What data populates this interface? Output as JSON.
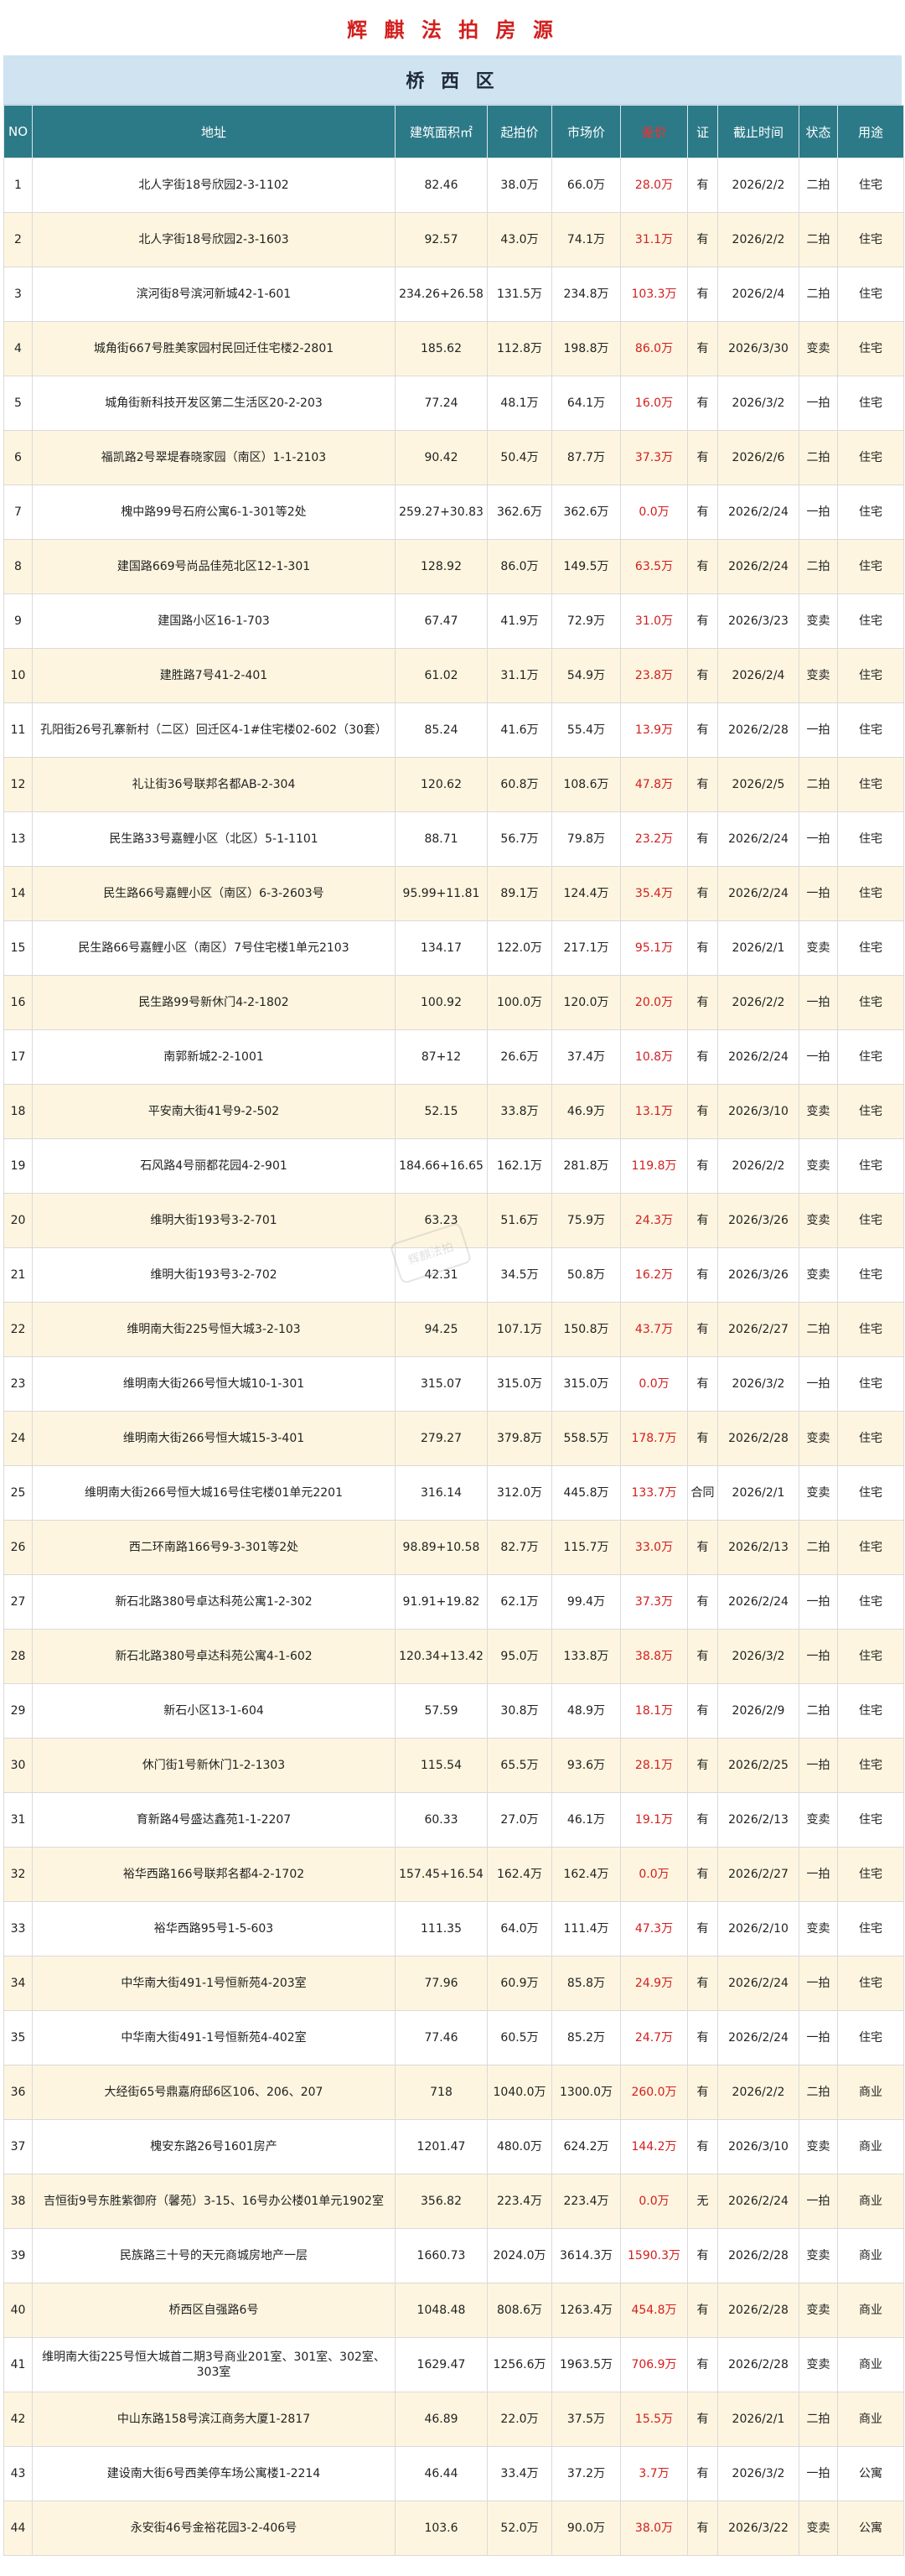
{
  "title": "辉 麒 法 拍 房 源",
  "district": "桥 西 区",
  "watermark": "辉麒法拍",
  "colors": {
    "title": "#d2201e",
    "header_bg": "#2c7a88",
    "district_bg": "#cfe3f1",
    "alt_row": "#fdf5df",
    "diff": "#d21e1e"
  },
  "columns": [
    "NO",
    "地址",
    "建筑面积㎡",
    "起拍价",
    "市场价",
    "差价",
    "证",
    "截止时间",
    "状态",
    "用途"
  ],
  "rows": [
    [
      "1",
      "北人字街18号欣园2-3-1102",
      "82.46",
      "38.0万",
      "66.0万",
      "28.0万",
      "有",
      "2026/2/2",
      "二拍",
      "住宅"
    ],
    [
      "2",
      "北人字街18号欣园2-3-1603",
      "92.57",
      "43.0万",
      "74.1万",
      "31.1万",
      "有",
      "2026/2/2",
      "二拍",
      "住宅"
    ],
    [
      "3",
      "滨河街8号滨河新城42-1-601",
      "234.26+26.58",
      "131.5万",
      "234.8万",
      "103.3万",
      "有",
      "2026/2/4",
      "二拍",
      "住宅"
    ],
    [
      "4",
      "城角街667号胜美家园村民回迁住宅楼2-2801",
      "185.62",
      "112.8万",
      "198.8万",
      "86.0万",
      "有",
      "2026/3/30",
      "变卖",
      "住宅"
    ],
    [
      "5",
      "城角街新科技开发区第二生活区20-2-203",
      "77.24",
      "48.1万",
      "64.1万",
      "16.0万",
      "有",
      "2026/3/2",
      "一拍",
      "住宅"
    ],
    [
      "6",
      "福凯路2号翠堤春晓家园（南区）1-1-2103",
      "90.42",
      "50.4万",
      "87.7万",
      "37.3万",
      "有",
      "2026/2/6",
      "二拍",
      "住宅"
    ],
    [
      "7",
      "槐中路99号石府公寓6-1-301等2处",
      "259.27+30.83",
      "362.6万",
      "362.6万",
      "0.0万",
      "有",
      "2026/2/24",
      "一拍",
      "住宅"
    ],
    [
      "8",
      "建国路669号尚品佳苑北区12-1-301",
      "128.92",
      "86.0万",
      "149.5万",
      "63.5万",
      "有",
      "2026/2/24",
      "二拍",
      "住宅"
    ],
    [
      "9",
      "建国路小区16-1-703",
      "67.47",
      "41.9万",
      "72.9万",
      "31.0万",
      "有",
      "2026/3/23",
      "变卖",
      "住宅"
    ],
    [
      "10",
      "建胜路7号41-2-401",
      "61.02",
      "31.1万",
      "54.9万",
      "23.8万",
      "有",
      "2026/2/4",
      "变卖",
      "住宅"
    ],
    [
      "11",
      "孔阳街26号孔寨新村（二区）回迁区4-1#住宅楼02-602（30套）",
      "85.24",
      "41.6万",
      "55.4万",
      "13.9万",
      "有",
      "2026/2/28",
      "一拍",
      "住宅"
    ],
    [
      "12",
      "礼让街36号联邦名都AB-2-304",
      "120.62",
      "60.8万",
      "108.6万",
      "47.8万",
      "有",
      "2026/2/5",
      "二拍",
      "住宅"
    ],
    [
      "13",
      "民生路33号嘉鲤小区（北区）5-1-1101",
      "88.71",
      "56.7万",
      "79.8万",
      "23.2万",
      "有",
      "2026/2/24",
      "一拍",
      "住宅"
    ],
    [
      "14",
      "民生路66号嘉鲤小区（南区）6-3-2603号",
      "95.99+11.81",
      "89.1万",
      "124.4万",
      "35.4万",
      "有",
      "2026/2/24",
      "一拍",
      "住宅"
    ],
    [
      "15",
      "民生路66号嘉鲤小区（南区）7号住宅楼1单元2103",
      "134.17",
      "122.0万",
      "217.1万",
      "95.1万",
      "有",
      "2026/2/1",
      "变卖",
      "住宅"
    ],
    [
      "16",
      "民生路99号新休门4-2-1802",
      "100.92",
      "100.0万",
      "120.0万",
      "20.0万",
      "有",
      "2026/2/2",
      "一拍",
      "住宅"
    ],
    [
      "17",
      "南郭新城2-2-1001",
      "87+12",
      "26.6万",
      "37.4万",
      "10.8万",
      "有",
      "2026/2/24",
      "一拍",
      "住宅"
    ],
    [
      "18",
      "平安南大街41号9-2-502",
      "52.15",
      "33.8万",
      "46.9万",
      "13.1万",
      "有",
      "2026/3/10",
      "变卖",
      "住宅"
    ],
    [
      "19",
      "石风路4号丽都花园4-2-901",
      "184.66+16.65",
      "162.1万",
      "281.8万",
      "119.8万",
      "有",
      "2026/2/2",
      "变卖",
      "住宅"
    ],
    [
      "20",
      "维明大街193号3-2-701",
      "63.23",
      "51.6万",
      "75.9万",
      "24.3万",
      "有",
      "2026/3/26",
      "变卖",
      "住宅"
    ],
    [
      "21",
      "维明大街193号3-2-702",
      "42.31",
      "34.5万",
      "50.8万",
      "16.2万",
      "有",
      "2026/3/26",
      "变卖",
      "住宅"
    ],
    [
      "22",
      "维明南大街225号恒大城3-2-103",
      "94.25",
      "107.1万",
      "150.8万",
      "43.7万",
      "有",
      "2026/2/27",
      "二拍",
      "住宅"
    ],
    [
      "23",
      "维明南大街266号恒大城10-1-301",
      "315.07",
      "315.0万",
      "315.0万",
      "0.0万",
      "有",
      "2026/3/2",
      "一拍",
      "住宅"
    ],
    [
      "24",
      "维明南大街266号恒大城15-3-401",
      "279.27",
      "379.8万",
      "558.5万",
      "178.7万",
      "有",
      "2026/2/28",
      "变卖",
      "住宅"
    ],
    [
      "25",
      "维明南大街266号恒大城16号住宅楼01单元2201",
      "316.14",
      "312.0万",
      "445.8万",
      "133.7万",
      "合同",
      "2026/2/1",
      "变卖",
      "住宅"
    ],
    [
      "26",
      "西二环南路166号9-3-301等2处",
      "98.89+10.58",
      "82.7万",
      "115.7万",
      "33.0万",
      "有",
      "2026/2/13",
      "二拍",
      "住宅"
    ],
    [
      "27",
      "新石北路380号卓达科苑公寓1-2-302",
      "91.91+19.82",
      "62.1万",
      "99.4万",
      "37.3万",
      "有",
      "2026/2/24",
      "一拍",
      "住宅"
    ],
    [
      "28",
      "新石北路380号卓达科苑公寓4-1-602",
      "120.34+13.42",
      "95.0万",
      "133.8万",
      "38.8万",
      "有",
      "2026/3/2",
      "一拍",
      "住宅"
    ],
    [
      "29",
      "新石小区13-1-604",
      "57.59",
      "30.8万",
      "48.9万",
      "18.1万",
      "有",
      "2026/2/9",
      "二拍",
      "住宅"
    ],
    [
      "30",
      "休门街1号新休门1-2-1303",
      "115.54",
      "65.5万",
      "93.6万",
      "28.1万",
      "有",
      "2026/2/25",
      "一拍",
      "住宅"
    ],
    [
      "31",
      "育新路4号盛达鑫苑1-1-2207",
      "60.33",
      "27.0万",
      "46.1万",
      "19.1万",
      "有",
      "2026/2/13",
      "变卖",
      "住宅"
    ],
    [
      "32",
      "裕华西路166号联邦名都4-2-1702",
      "157.45+16.54",
      "162.4万",
      "162.4万",
      "0.0万",
      "有",
      "2026/2/27",
      "一拍",
      "住宅"
    ],
    [
      "33",
      "裕华西路95号1-5-603",
      "111.35",
      "64.0万",
      "111.4万",
      "47.3万",
      "有",
      "2026/2/10",
      "变卖",
      "住宅"
    ],
    [
      "34",
      "中华南大街491-1号恒新苑4-203室",
      "77.96",
      "60.9万",
      "85.8万",
      "24.9万",
      "有",
      "2026/2/24",
      "一拍",
      "住宅"
    ],
    [
      "35",
      "中华南大街491-1号恒新苑4-402室",
      "77.46",
      "60.5万",
      "85.2万",
      "24.7万",
      "有",
      "2026/2/24",
      "一拍",
      "住宅"
    ],
    [
      "36",
      "大经街65号鼎嘉府邸6区106、206、207",
      "718",
      "1040.0万",
      "1300.0万",
      "260.0万",
      "有",
      "2026/2/2",
      "二拍",
      "商业"
    ],
    [
      "37",
      "槐安东路26号1601房产",
      "1201.47",
      "480.0万",
      "624.2万",
      "144.2万",
      "有",
      "2026/3/10",
      "变卖",
      "商业"
    ],
    [
      "38",
      "吉恒街9号东胜紫御府（馨苑）3-15、16号办公楼01单元1902室",
      "356.82",
      "223.4万",
      "223.4万",
      "0.0万",
      "无",
      "2026/2/24",
      "一拍",
      "商业"
    ],
    [
      "39",
      "民族路三十号的天元商城房地产一层",
      "1660.73",
      "2024.0万",
      "3614.3万",
      "1590.3万",
      "有",
      "2026/2/28",
      "变卖",
      "商业"
    ],
    [
      "40",
      "桥西区自强路6号",
      "1048.48",
      "808.6万",
      "1263.4万",
      "454.8万",
      "有",
      "2026/2/28",
      "变卖",
      "商业"
    ],
    [
      "41",
      "维明南大街225号恒大城首二期3号商业201室、301室、302室、303室",
      "1629.47",
      "1256.6万",
      "1963.5万",
      "706.9万",
      "有",
      "2026/2/28",
      "变卖",
      "商业"
    ],
    [
      "42",
      "中山东路158号滨江商务大厦1-2817",
      "46.89",
      "22.0万",
      "37.5万",
      "15.5万",
      "有",
      "2026/2/1",
      "二拍",
      "商业"
    ],
    [
      "43",
      "建设南大街6号西美停车场公寓楼1-2214",
      "46.44",
      "33.4万",
      "37.2万",
      "3.7万",
      "有",
      "2026/3/2",
      "一拍",
      "公寓"
    ],
    [
      "44",
      "永安街46号金裕花园3-2-406号",
      "103.6",
      "52.0万",
      "90.0万",
      "38.0万",
      "有",
      "2026/3/22",
      "变卖",
      "公寓"
    ]
  ]
}
